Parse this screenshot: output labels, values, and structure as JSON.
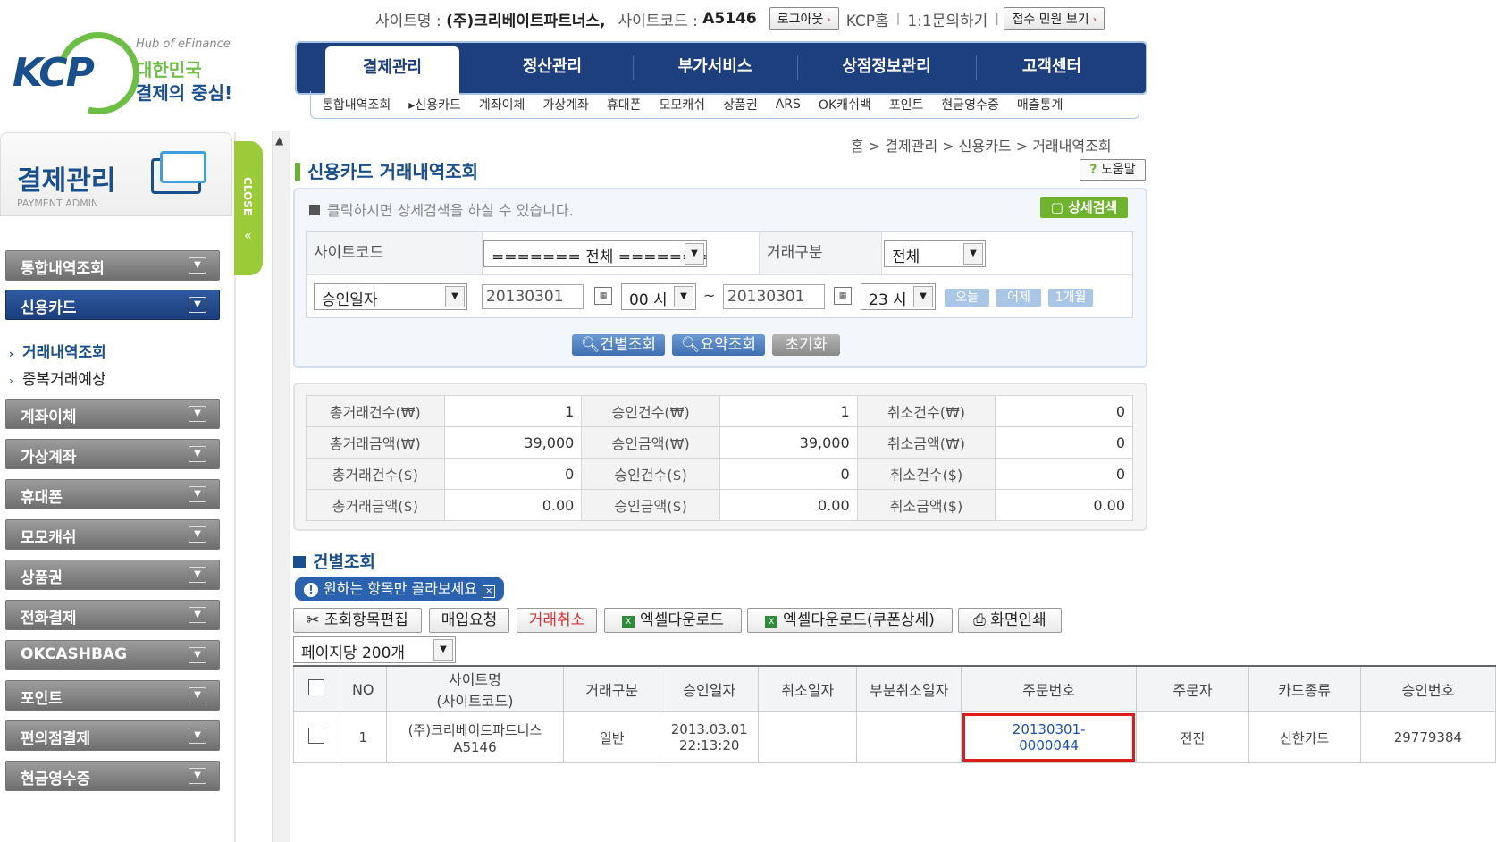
{
  "topbar": {
    "site_name_label": "사이트명 :",
    "site_name": "(주)크리베이트파트너스,",
    "site_code_label": "사이트코드 :",
    "site_code": "A5146",
    "logout": "로그아웃",
    "home": "KCP홈",
    "inquiry": "1:1문의하기",
    "complaint": "접수 민원 보기"
  },
  "logo": {
    "brand": "KCP",
    "hub": "Hub of eFinance",
    "line1": "대한민국",
    "line2": "결제의 중심!"
  },
  "nav": {
    "tabs": [
      "결제관리",
      "정산관리",
      "부가서비스",
      "상점정보관리",
      "고객센터"
    ],
    "sub": [
      "통합내역조회",
      "▸신용카드",
      "계좌이체",
      "가상계좌",
      "휴대폰",
      "모모캐쉬",
      "상품권",
      "ARS",
      "OK캐쉬백",
      "포인트",
      "현금영수증",
      "매출통계"
    ]
  },
  "sidebar": {
    "title": "결제관리",
    "subtitle": "PAYMENT ADMIN",
    "close": "CLOSE",
    "items": [
      "통합내역조회",
      "신용카드",
      "계좌이체",
      "가상계좌",
      "휴대폰",
      "모모캐쉬",
      "상품권",
      "전화결제",
      "OKCASHBAG",
      "포인트",
      "편의점결제",
      "현금영수증"
    ],
    "subitems": [
      "거래내역조회",
      "중복거래예상"
    ]
  },
  "breadcrumb": "홈 > 결제관리 > 신용카드 > 거래내역조회",
  "page_title": "신용카드 거래내역조회",
  "help": "도움말",
  "search": {
    "info": "클릭하시면 상세검색을 하실 수 있습니다.",
    "detail": "상세검색",
    "site_code_label": "사이트코드",
    "site_code_value": "======= 전체 =======",
    "trade_type_label": "거래구분",
    "trade_type_value": "전체",
    "date_type": "승인일자",
    "from_date": "20130301",
    "from_hour": "00 시",
    "tilde": "~",
    "to_date": "20130301",
    "to_hour": "23 시",
    "today": "오늘",
    "yesterday": "어제",
    "month": "1개월",
    "btn_detail": "건별조회",
    "btn_summary": "요약조회",
    "btn_reset": "초기화"
  },
  "summary": {
    "rows": [
      [
        "총거래건수(₩)",
        "1",
        "승인건수(₩)",
        "1",
        "취소건수(₩)",
        "0"
      ],
      [
        "총거래금액(₩)",
        "39,000",
        "승인금액(₩)",
        "39,000",
        "취소금액(₩)",
        "0"
      ],
      [
        "총거래건수($)",
        "0",
        "승인건수($)",
        "0",
        "취소건수($)",
        "0"
      ],
      [
        "총거래금액($)",
        "0.00",
        "승인금액($)",
        "0.00",
        "취소금액($)",
        "0.00"
      ]
    ]
  },
  "list": {
    "title": "건별조회",
    "tip": "원하는 항목만 골라보세요",
    "buttons": [
      "조회항목편집",
      "매입요청",
      "거래취소",
      "엑셀다운로드",
      "엑셀다운로드(쿠폰상세)",
      "화면인쇄"
    ],
    "page_size": "페이지당 200개",
    "headers": [
      "NO",
      "사이트명\n(사이트코드)",
      "거래구분",
      "승인일자",
      "취소일자",
      "부분취소일자",
      "주문번호",
      "주문자",
      "카드종류",
      "승인번호"
    ],
    "rows": [
      {
        "no": "1",
        "site_name": "(주)크리베이트파트너스",
        "site_code": "A5146",
        "type": "일반",
        "date": "2013.03.01",
        "time": "22:13:20",
        "cancel": "",
        "partial": "",
        "order": "20130301-0000044",
        "orderer": "전진",
        "card": "신한카드",
        "approval": "29779384"
      }
    ]
  }
}
